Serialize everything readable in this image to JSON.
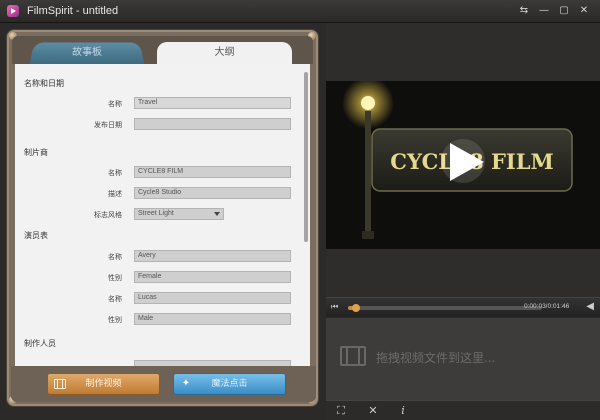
{
  "window": {
    "title": "FilmSpirit - untitled",
    "controls": [
      "⇆",
      "—",
      "▢",
      "✕"
    ]
  },
  "tabs": [
    {
      "label": "故事板"
    },
    {
      "label": "大纲"
    }
  ],
  "form": {
    "sections": {
      "name_date": "名称和日期",
      "producer": "制片商",
      "cast": "演员表",
      "crew": "制作人员"
    },
    "name_date": {
      "name_label": "名称",
      "name_value": "Travel",
      "release_label": "发布日期",
      "release_value": ""
    },
    "producer": {
      "name_label": "名称",
      "name_value": "CYCLE8 FILM",
      "desc_label": "描述",
      "desc_value": "Cycle8 Studio",
      "style_label": "标志风格",
      "style_value": "Street Light"
    },
    "cast": [
      {
        "name_label": "名称",
        "name_value": "Avery",
        "gender_label": "性别",
        "gender_value": "Female"
      },
      {
        "name_label": "名称",
        "name_value": "Lucas",
        "gender_label": "性别",
        "gender_value": "Male"
      }
    ]
  },
  "buttons": {
    "make_video": "制作视频",
    "magic_click": "魔法点击"
  },
  "player": {
    "title_text": "CYCLE8 FILM",
    "time": "0:00:03/0:01:46",
    "progress": 0.03
  },
  "drop_area": {
    "text": "拖拽视频文件到这里..."
  },
  "toolbar": {
    "icons": [
      "crop-icon",
      "delete-icon",
      "info-icon"
    ],
    "glyphs": [
      "⛶",
      "✕",
      "i"
    ]
  },
  "colors": {
    "accent_orange": "#c07b34",
    "accent_blue": "#3a8dc6",
    "tab_blue": "#4a7d94"
  }
}
